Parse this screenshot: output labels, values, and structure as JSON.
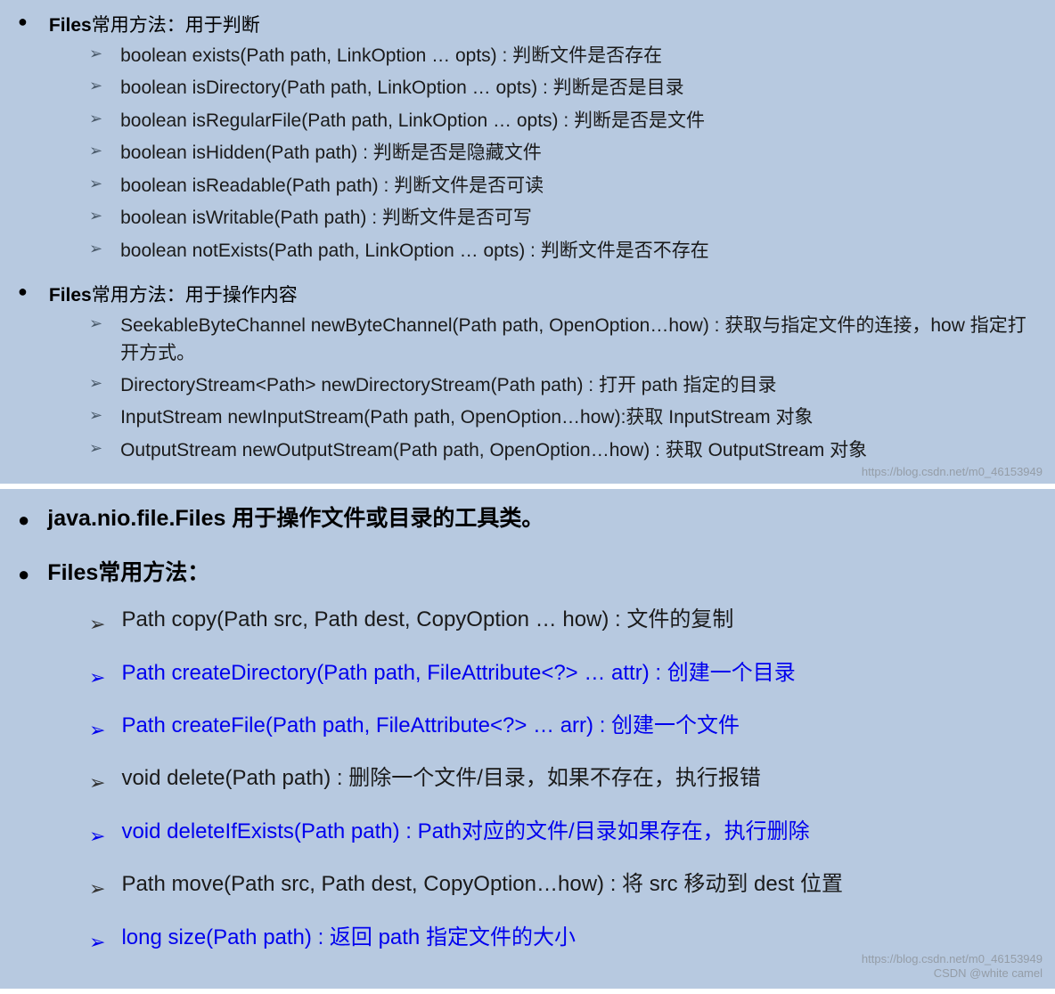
{
  "panel1": {
    "section1": {
      "heading_bold": "Files",
      "heading_rest": "常用方法：用于判断",
      "items": [
        "boolean exists(Path path, LinkOption … opts) : 判断文件是否存在",
        "boolean isDirectory(Path path, LinkOption … opts) : 判断是否是目录",
        "boolean isRegularFile(Path path, LinkOption … opts) : 判断是否是文件",
        "boolean isHidden(Path path) : 判断是否是隐藏文件",
        "boolean isReadable(Path path) : 判断文件是否可读",
        "boolean isWritable(Path path) : 判断文件是否可写",
        "boolean notExists(Path path, LinkOption … opts) : 判断文件是否不存在"
      ]
    },
    "section2": {
      "heading_bold": "Files",
      "heading_rest": "常用方法：用于操作内容",
      "items": [
        "SeekableByteChannel newByteChannel(Path path, OpenOption…how) : 获取与指定文件的连接，how 指定打开方式。",
        "DirectoryStream<Path>  newDirectoryStream(Path path) : 打开 path 指定的目录",
        "InputStream newInputStream(Path path, OpenOption…how):获取 InputStream 对象",
        "OutputStream newOutputStream(Path path, OpenOption…how) : 获取 OutputStream 对象"
      ]
    },
    "watermark": "https://blog.csdn.net/m0_46153949"
  },
  "panel2": {
    "heading1": "java.nio.file.Files 用于操作文件或目录的工具类。",
    "heading2_bold": "Files",
    "heading2_rest": "常用方法：",
    "items": [
      {
        "text": "Path copy(Path src, Path dest, CopyOption … how) : 文件的复制",
        "blue": false
      },
      {
        "text": "Path createDirectory(Path path, FileAttribute<?> … attr) : 创建一个目录",
        "blue": true
      },
      {
        "text": "Path createFile(Path path, FileAttribute<?> … arr) : 创建一个文件",
        "blue": true
      },
      {
        "text": "void delete(Path path) : 删除一个文件/目录，如果不存在，执行报错",
        "blue": false
      },
      {
        "text": "void deleteIfExists(Path path) : Path对应的文件/目录如果存在，执行删除",
        "blue": true
      },
      {
        "text": "Path move(Path src, Path dest, CopyOption…how) : 将 src 移动到 dest 位置",
        "blue": false
      },
      {
        "text": "long size(Path path) : 返回 path 指定文件的大小",
        "blue": true
      }
    ],
    "watermark_url": "https://blog.csdn.net/m0_46153949",
    "watermark_csdn": "CSDN @white camel"
  }
}
